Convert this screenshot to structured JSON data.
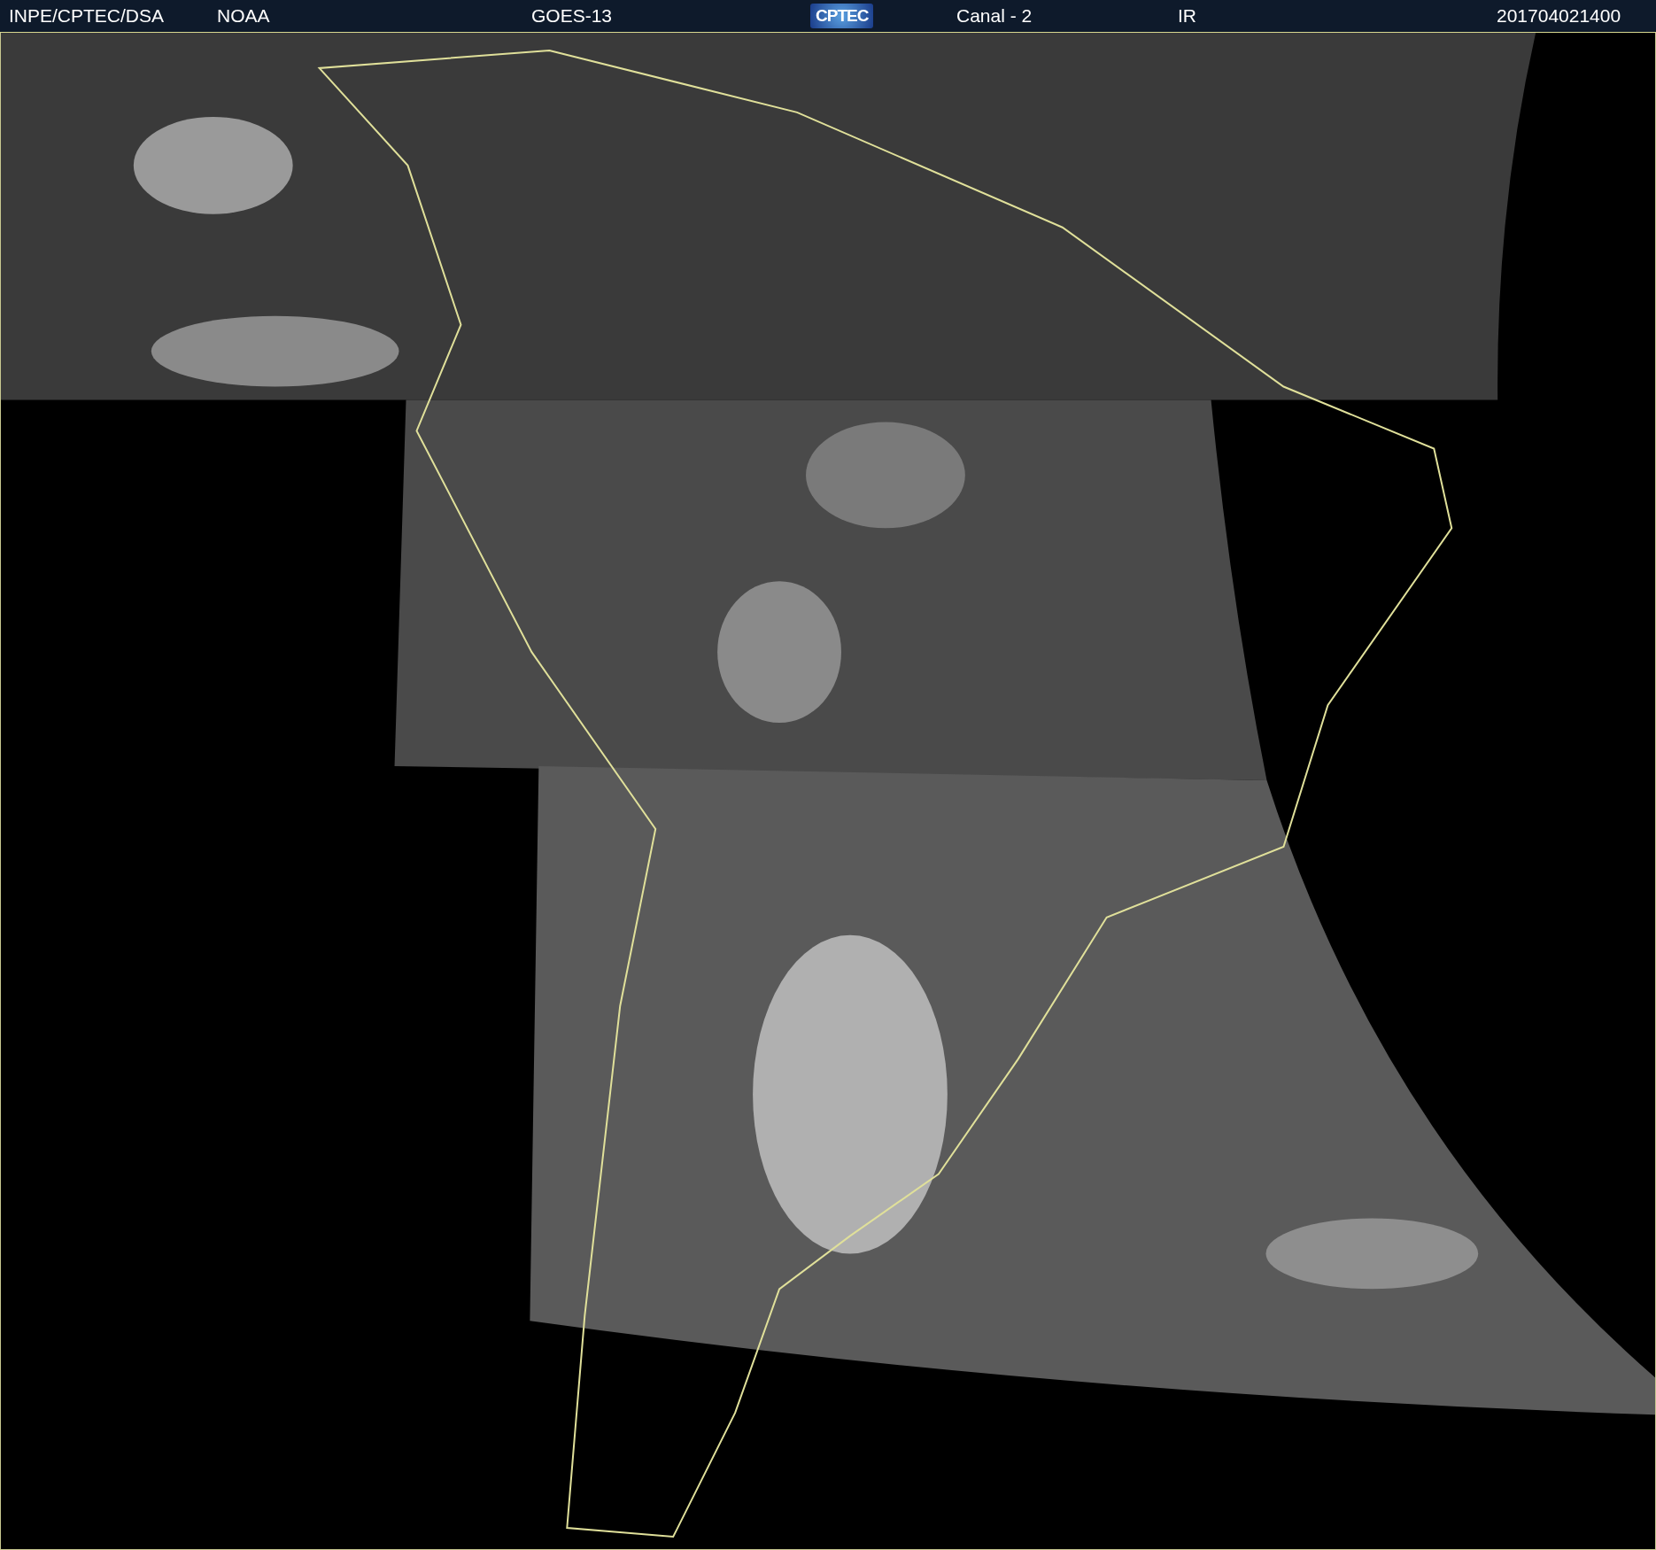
{
  "header": {
    "items": [
      {
        "kind": "text",
        "text": "INPE/CPTEC/DSA"
      },
      {
        "kind": "text",
        "text": "NOAA"
      },
      {
        "kind": "text",
        "text": "GOES-13"
      },
      {
        "kind": "logo",
        "text": "CPTEC"
      },
      {
        "kind": "text",
        "text": "Canal - 2"
      },
      {
        "kind": "text",
        "text": "IR"
      },
      {
        "kind": "text",
        "text": "201704021400"
      }
    ]
  }
}
